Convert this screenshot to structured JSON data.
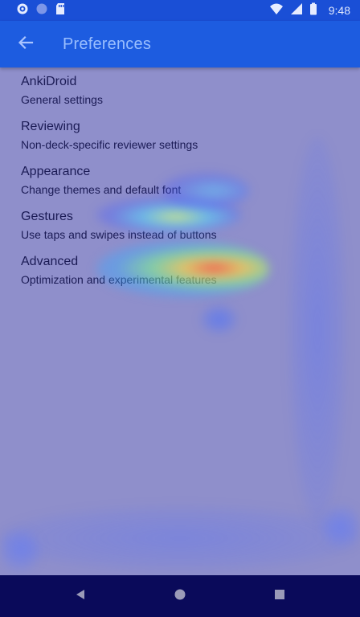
{
  "status_bar": {
    "time": "9:48",
    "icons": [
      "settings-icon",
      "sync-circle-icon",
      "sd-card-icon",
      "wifi-icon",
      "signal-icon",
      "battery-icon"
    ]
  },
  "app_bar": {
    "title": "Preferences",
    "back_icon": "arrow-back-icon"
  },
  "preferences": {
    "items": [
      {
        "title": "AnkiDroid",
        "summary": "General settings"
      },
      {
        "title": "Reviewing",
        "summary": "Non-deck-specific reviewer settings"
      },
      {
        "title": "Appearance",
        "summary": "Change themes and default font"
      },
      {
        "title": "Gestures",
        "summary": "Use taps and swipes instead of buttons"
      },
      {
        "title": "Advanced",
        "summary": "Optimization and experimental features"
      }
    ]
  },
  "nav_bar": {
    "icons": [
      "back-triangle-icon",
      "home-circle-icon",
      "recents-square-icon"
    ]
  },
  "colors": {
    "status_bar": "#1a4fd6",
    "app_bar": "#1d5ce0",
    "list_background": "#8f8fcb",
    "text": "#1b1b55",
    "nav_bar": "#0a0a5a"
  }
}
